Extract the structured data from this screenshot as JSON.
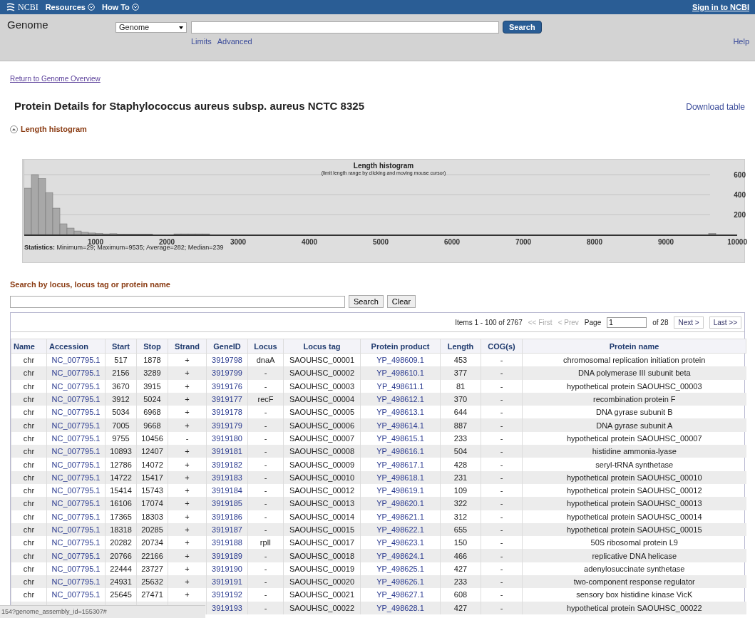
{
  "top_bar": {
    "logo": "NCBI",
    "menus": [
      "Resources",
      "How To"
    ],
    "sign_in": "Sign in to NCBI"
  },
  "search_band": {
    "title": "Genome",
    "database": "Genome",
    "button": "Search",
    "links": [
      "Limits",
      "Advanced"
    ],
    "help": "Help"
  },
  "back_link": "Return to Genome Overview",
  "page_title": "Protein Details for Staphylococcus aureus subsp. aureus NCTC 8325",
  "download_link": "Download table",
  "histogram_toggle": {
    "label": "Length histogram",
    "expanded": true
  },
  "histogram": {
    "chart_data": {
      "type": "bar",
      "title": "Length histogram",
      "subtitle": "(limit length range by clicking and moving mouse cursor)",
      "x": [
        50,
        150,
        250,
        350,
        450,
        550,
        650,
        750,
        850,
        950,
        1050,
        1150,
        1250,
        1350,
        1450,
        1550,
        1650,
        1750,
        2150,
        2250,
        2350,
        2450,
        2550,
        9650
      ],
      "values": [
        464,
        600,
        560,
        420,
        264,
        107,
        64,
        35,
        22,
        15,
        10,
        6,
        8,
        5,
        5,
        5,
        5,
        5,
        6,
        6,
        6,
        6,
        6,
        10
      ],
      "xlim": [
        0,
        10000
      ],
      "ylim": [
        0,
        750
      ],
      "grid": true,
      "xticks": [
        1000,
        2000,
        3000,
        4000,
        5000,
        6000,
        7000,
        8000,
        9000,
        10000
      ],
      "yticks": [
        200,
        400,
        600
      ]
    },
    "statistics": "**Statistics:** Minimum=29; Maximum=9535; Average=282; Median=239"
  },
  "locus_search": {
    "label": "Search by locus, locus tag or protein name",
    "buttons": [
      "Search",
      "Clear"
    ]
  },
  "pager": {
    "items": "Items 1 - 100 of 2767",
    "first": {
      "label": "<< First",
      "disabled": true
    },
    "prev": {
      "label": "< Prev",
      "disabled": true
    },
    "page_label": "Page",
    "page": "1",
    "of": "of 28",
    "next": {
      "label": "Next >",
      "disabled": false
    },
    "last": {
      "label": "Last >>",
      "disabled": false
    }
  },
  "table": {
    "columns": [
      "Name",
      "Accession",
      "Start",
      "Stop",
      "Strand",
      "GeneID",
      "Locus",
      "Locus tag",
      "Protein product",
      "Length",
      "COG(s)",
      "Protein name"
    ],
    "rows": [
      {
        "name": "chr",
        "accession": "NC_007795.1",
        "start": "517",
        "stop": "1878",
        "strand": "+",
        "gene_id": "3919798",
        "locus": "dnaA",
        "locus_tag": "SAOUHSC_00001",
        "protein_product": "YP_498609.1",
        "length": "453",
        "cog": "-",
        "protein_name": "chromosomal replication initiation protein"
      },
      {
        "name": "chr",
        "accession": "NC_007795.1",
        "start": "2156",
        "stop": "3289",
        "strand": "+",
        "gene_id": "3919799",
        "locus": "-",
        "locus_tag": "SAOUHSC_00002",
        "protein_product": "YP_498610.1",
        "length": "377",
        "cog": "-",
        "protein_name": "DNA polymerase III subunit beta"
      },
      {
        "name": "chr",
        "accession": "NC_007795.1",
        "start": "3670",
        "stop": "3915",
        "strand": "+",
        "gene_id": "3919176",
        "locus": "-",
        "locus_tag": "SAOUHSC_00003",
        "protein_product": "YP_498611.1",
        "length": "81",
        "cog": "-",
        "protein_name": "hypothetical protein SAOUHSC_00003"
      },
      {
        "name": "chr",
        "accession": "NC_007795.1",
        "start": "3912",
        "stop": "5024",
        "strand": "+",
        "gene_id": "3919177",
        "locus": "recF",
        "locus_tag": "SAOUHSC_00004",
        "protein_product": "YP_498612.1",
        "length": "370",
        "cog": "-",
        "protein_name": "recombination protein F"
      },
      {
        "name": "chr",
        "accession": "NC_007795.1",
        "start": "5034",
        "stop": "6968",
        "strand": "+",
        "gene_id": "3919178",
        "locus": "-",
        "locus_tag": "SAOUHSC_00005",
        "protein_product": "YP_498613.1",
        "length": "644",
        "cog": "-",
        "protein_name": "DNA gyrase subunit B"
      },
      {
        "name": "chr",
        "accession": "NC_007795.1",
        "start": "7005",
        "stop": "9668",
        "strand": "+",
        "gene_id": "3919179",
        "locus": "-",
        "locus_tag": "SAOUHSC_00006",
        "protein_product": "YP_498614.1",
        "length": "887",
        "cog": "-",
        "protein_name": "DNA gyrase subunit A"
      },
      {
        "name": "chr",
        "accession": "NC_007795.1",
        "start": "9755",
        "stop": "10456",
        "strand": "-",
        "gene_id": "3919180",
        "locus": "-",
        "locus_tag": "SAOUHSC_00007",
        "protein_product": "YP_498615.1",
        "length": "233",
        "cog": "-",
        "protein_name": "hypothetical protein SAOUHSC_00007"
      },
      {
        "name": "chr",
        "accession": "NC_007795.1",
        "start": "10893",
        "stop": "12407",
        "strand": "+",
        "gene_id": "3919181",
        "locus": "-",
        "locus_tag": "SAOUHSC_00008",
        "protein_product": "YP_498616.1",
        "length": "504",
        "cog": "-",
        "protein_name": "histidine ammonia-lyase"
      },
      {
        "name": "chr",
        "accession": "NC_007795.1",
        "start": "12786",
        "stop": "14072",
        "strand": "+",
        "gene_id": "3919182",
        "locus": "-",
        "locus_tag": "SAOUHSC_00009",
        "protein_product": "YP_498617.1",
        "length": "428",
        "cog": "-",
        "protein_name": "seryl-tRNA synthetase"
      },
      {
        "name": "chr",
        "accession": "NC_007795.1",
        "start": "14722",
        "stop": "15417",
        "strand": "+",
        "gene_id": "3919183",
        "locus": "-",
        "locus_tag": "SAOUHSC_00010",
        "protein_product": "YP_498618.1",
        "length": "231",
        "cog": "-",
        "protein_name": "hypothetical protein SAOUHSC_00010"
      },
      {
        "name": "chr",
        "accession": "NC_007795.1",
        "start": "15414",
        "stop": "15743",
        "strand": "+",
        "gene_id": "3919184",
        "locus": "-",
        "locus_tag": "SAOUHSC_00012",
        "protein_product": "YP_498619.1",
        "length": "109",
        "cog": "-",
        "protein_name": "hypothetical protein SAOUHSC_00012"
      },
      {
        "name": "chr",
        "accession": "NC_007795.1",
        "start": "16106",
        "stop": "17074",
        "strand": "+",
        "gene_id": "3919185",
        "locus": "-",
        "locus_tag": "SAOUHSC_00013",
        "protein_product": "YP_498620.1",
        "length": "322",
        "cog": "-",
        "protein_name": "hypothetical protein SAOUHSC_00013"
      },
      {
        "name": "chr",
        "accession": "NC_007795.1",
        "start": "17365",
        "stop": "18303",
        "strand": "+",
        "gene_id": "3919186",
        "locus": "-",
        "locus_tag": "SAOUHSC_00014",
        "protein_product": "YP_498621.1",
        "length": "312",
        "cog": "-",
        "protein_name": "hypothetical protein SAOUHSC_00014"
      },
      {
        "name": "chr",
        "accession": "NC_007795.1",
        "start": "18318",
        "stop": "20285",
        "strand": "+",
        "gene_id": "3919187",
        "locus": "-",
        "locus_tag": "SAOUHSC_00015",
        "protein_product": "YP_498622.1",
        "length": "655",
        "cog": "-",
        "protein_name": "hypothetical protein SAOUHSC_00015"
      },
      {
        "name": "chr",
        "accession": "NC_007795.1",
        "start": "20282",
        "stop": "20734",
        "strand": "+",
        "gene_id": "3919188",
        "locus": "rplI",
        "locus_tag": "SAOUHSC_00017",
        "protein_product": "YP_498623.1",
        "length": "150",
        "cog": "-",
        "protein_name": "50S ribosomal protein L9"
      },
      {
        "name": "chr",
        "accession": "NC_007795.1",
        "start": "20766",
        "stop": "22166",
        "strand": "+",
        "gene_id": "3919189",
        "locus": "-",
        "locus_tag": "SAOUHSC_00018",
        "protein_product": "YP_498624.1",
        "length": "466",
        "cog": "-",
        "protein_name": "replicative DNA helicase"
      },
      {
        "name": "chr",
        "accession": "NC_007795.1",
        "start": "22444",
        "stop": "23727",
        "strand": "+",
        "gene_id": "3919190",
        "locus": "-",
        "locus_tag": "SAOUHSC_00019",
        "protein_product": "YP_498625.1",
        "length": "427",
        "cog": "-",
        "protein_name": "adenylosuccinate synthetase"
      },
      {
        "name": "chr",
        "accession": "NC_007795.1",
        "start": "24931",
        "stop": "25632",
        "strand": "+",
        "gene_id": "3919191",
        "locus": "-",
        "locus_tag": "SAOUHSC_00020",
        "protein_product": "YP_498626.1",
        "length": "233",
        "cog": "-",
        "protein_name": "two-component response regulator"
      },
      {
        "name": "chr",
        "accession": "NC_007795.1",
        "start": "25645",
        "stop": "27471",
        "strand": "+",
        "gene_id": "3919192",
        "locus": "-",
        "locus_tag": "SAOUHSC_00021",
        "protein_product": "YP_498627.1",
        "length": "608",
        "cog": "-",
        "protein_name": "sensory box histidine kinase VicK"
      },
      {
        "gene_id": "3919193",
        "locus": "-",
        "locus_tag": "SAOUHSC_00022",
        "protein_product": "YP_498628.1",
        "length": "427",
        "cog": "-",
        "protein_name": "hypothetical protein SAOUHSC_00022"
      }
    ]
  },
  "status_bar": "154?genome_assembly_id=155307#"
}
